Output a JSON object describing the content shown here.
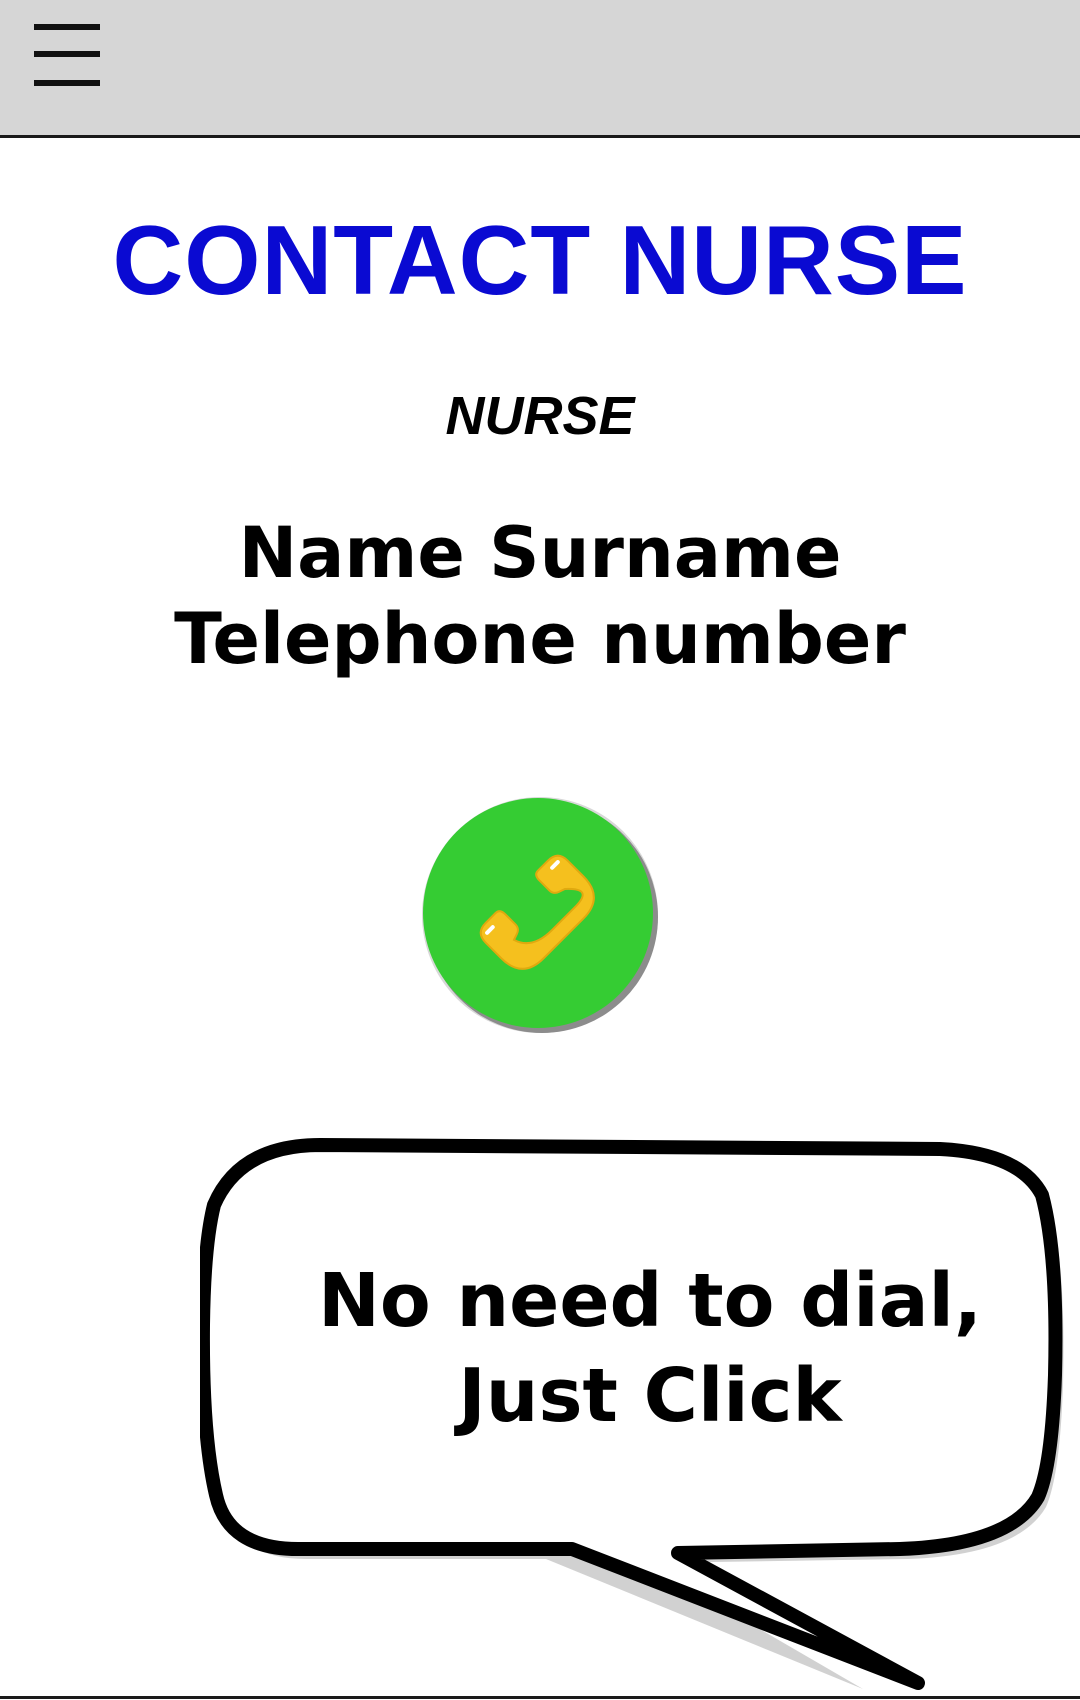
{
  "header": {
    "menu_icon": "hamburger-menu-icon"
  },
  "main": {
    "title": "CONTACT NURSE",
    "role_label": "NURSE",
    "contact_name": "Name Surname",
    "contact_phone": "Telephone number",
    "call_icon": "phone-handset-icon"
  },
  "callout": {
    "line1": "No need to dial,",
    "line2": "Just Click"
  },
  "colors": {
    "topbar_bg": "#d6d6d6",
    "title": "#0a0ad2",
    "call_button_fill": "#35cc33",
    "phone_icon": "#f5c01e",
    "text": "#000000"
  }
}
